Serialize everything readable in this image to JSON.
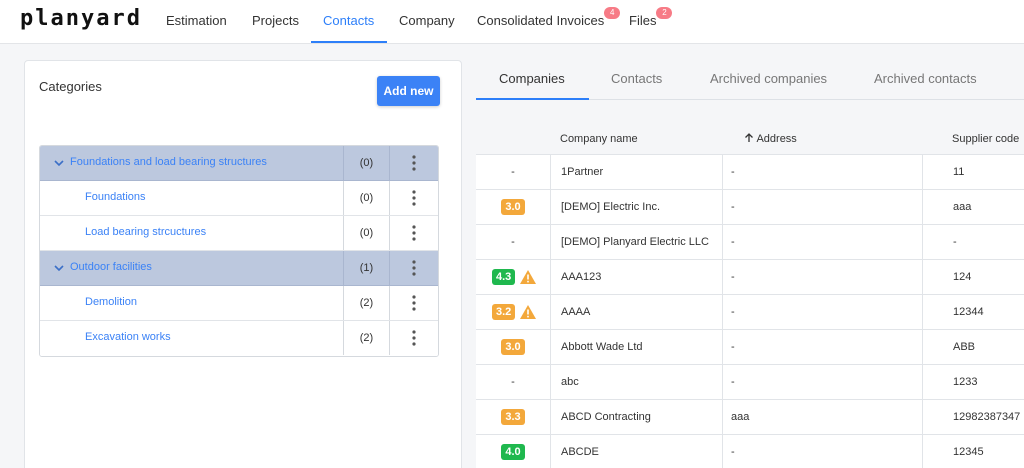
{
  "app": {
    "logo": "planyard"
  },
  "nav": {
    "items": [
      {
        "label": "Estimation",
        "active": false
      },
      {
        "label": "Projects",
        "active": false
      },
      {
        "label": "Contacts",
        "active": true
      },
      {
        "label": "Company",
        "active": false
      },
      {
        "label": "Consolidated Invoices",
        "active": false,
        "badge": "4"
      },
      {
        "label": "Files",
        "active": false,
        "badge": "2"
      }
    ]
  },
  "categories": {
    "title": "Categories",
    "add_label": "Add new",
    "rows": [
      {
        "type": "group",
        "label": "Foundations and load bearing structures",
        "count": "(0)",
        "expanded": true
      },
      {
        "type": "child",
        "label": "Foundations",
        "count": "(0)"
      },
      {
        "type": "child",
        "label": "Load bearing strcuctures",
        "count": "(0)"
      },
      {
        "type": "group",
        "label": "Outdoor facilities",
        "count": "(1)",
        "expanded": true
      },
      {
        "type": "child",
        "label": "Demolition",
        "count": "(2)"
      },
      {
        "type": "child",
        "label": "Excavation works",
        "count": "(2)"
      }
    ]
  },
  "tabs": [
    {
      "label": "Companies",
      "active": true
    },
    {
      "label": "Contacts",
      "active": false
    },
    {
      "label": "Archived companies",
      "active": false
    },
    {
      "label": "Archived contacts",
      "active": false
    }
  ],
  "companies": {
    "columns": {
      "name": "Company name",
      "address": "Address",
      "address_sort_icon": "arrow-up-icon",
      "supplier_code": "Supplier code"
    },
    "rating_colors": {
      "green": "#1fb84e",
      "orange": "#f3a83b"
    },
    "rows": [
      {
        "rating": "-",
        "rating_color": "",
        "warning": false,
        "name": "1Partner",
        "address": "-",
        "supplier_code": "11"
      },
      {
        "rating": "3.0",
        "rating_color": "#f3a83b",
        "warning": false,
        "name": "[DEMO] Electric Inc.",
        "address": "-",
        "supplier_code": "aaa"
      },
      {
        "rating": "-",
        "rating_color": "",
        "warning": false,
        "name": "[DEMO] Planyard Electric LLC",
        "address": "-",
        "supplier_code": "-"
      },
      {
        "rating": "4.3",
        "rating_color": "#1fb84e",
        "warning": true,
        "name": "AAA123",
        "address": "-",
        "supplier_code": "124"
      },
      {
        "rating": "3.2",
        "rating_color": "#f3a83b",
        "warning": true,
        "name": "AAAA",
        "address": "-",
        "supplier_code": "12344"
      },
      {
        "rating": "3.0",
        "rating_color": "#f3a83b",
        "warning": false,
        "name": "Abbott Wade Ltd",
        "address": "-",
        "supplier_code": "ABB"
      },
      {
        "rating": "-",
        "rating_color": "",
        "warning": false,
        "name": "abc",
        "address": "-",
        "supplier_code": "1233"
      },
      {
        "rating": "3.3",
        "rating_color": "#f3a83b",
        "warning": false,
        "name": "ABCD Contracting",
        "address": "aaa",
        "supplier_code": "12982387347"
      },
      {
        "rating": "4.0",
        "rating_color": "#1fb84e",
        "warning": false,
        "name": "ABCDE",
        "address": "-",
        "supplier_code": "12345"
      }
    ]
  }
}
